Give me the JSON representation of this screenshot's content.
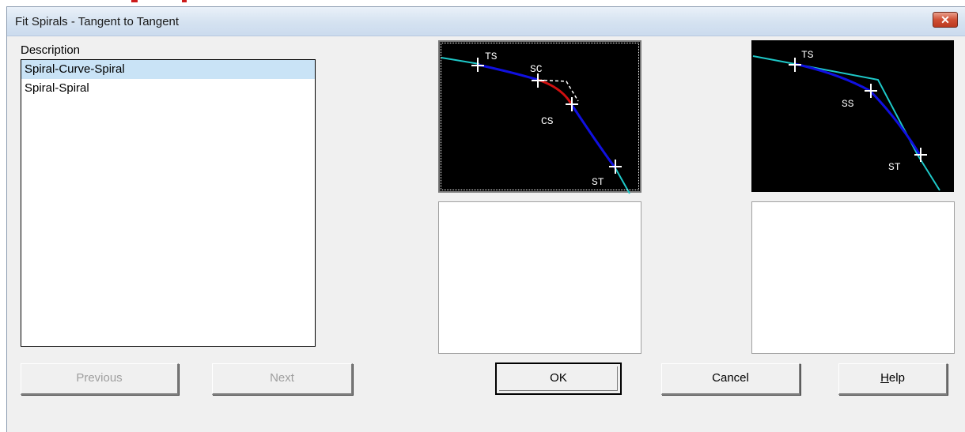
{
  "window": {
    "title": "Fit Spirals - Tangent to Tangent"
  },
  "description": {
    "label": "Description",
    "items": [
      {
        "label": "Spiral-Curve-Spiral",
        "selected": true
      },
      {
        "label": "Spiral-Spiral",
        "selected": false
      }
    ]
  },
  "previews": {
    "scs": {
      "labels": {
        "ts": "TS",
        "sc": "SC",
        "cs": "CS",
        "st": "ST"
      }
    },
    "ss": {
      "labels": {
        "ts": "TS",
        "ss": "SS",
        "st": "ST"
      }
    }
  },
  "buttons": {
    "previous": "Previous",
    "next": "Next",
    "ok": "OK",
    "cancel": "Cancel",
    "help_first": "H",
    "help_rest": "elp"
  },
  "colors": {
    "tangent": "#1ec8c8",
    "spiral": "#1010e0",
    "curve": "#d01010",
    "marker": "#ffffff"
  }
}
